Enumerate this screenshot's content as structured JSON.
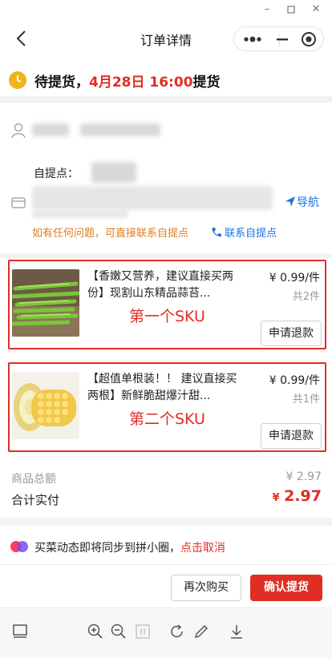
{
  "window": {
    "controls": [
      "minimize-icon",
      "maximize-icon",
      "close-icon"
    ]
  },
  "nav": {
    "title": "订单详情",
    "back_icon": "chevron-left-icon",
    "menu_icon": "more-dots-icon",
    "minimize_icon": "minimize-icon",
    "close_icon": "target-icon"
  },
  "status": {
    "prefix": "待提货，",
    "date_time": "4月28日 16:00",
    "suffix": "提货",
    "icon": "clock-icon"
  },
  "pickup": {
    "label": "自提点：",
    "navigate": "导航",
    "hint": "如有任何问题，可直接联系自提点",
    "contact": "联系自提点"
  },
  "items": [
    {
      "name": "【香嫩又营养，建议直接买两份】现割山东精品蒜苔...",
      "price": "¥ 0.99/件",
      "qty": "共2件",
      "sku_note": "第一个SKU",
      "refund": "申请退款"
    },
    {
      "name": "【超值单根装！！ 建议直接买两根】新鲜脆甜爆汁甜...",
      "price": "¥ 0.99/件",
      "qty": "共1件",
      "sku_note": "第二个SKU",
      "refund": "申请退款"
    }
  ],
  "totals": {
    "goods_label": "商品总额",
    "goods_value": "¥ 2.97",
    "paid_label": "合计实付",
    "paid_currency": "¥",
    "paid_value": "2.97"
  },
  "sync": {
    "text": "买菜动态即将同步到拼小圈，",
    "cancel": "点击取消"
  },
  "actions": {
    "buy_again": "再次购买",
    "confirm": "确认提货"
  },
  "toolbar": {
    "icons": [
      "panel-icon",
      "zoom-in-icon",
      "zoom-out-icon",
      "actual-size-icon",
      "rotate-icon",
      "edit-icon",
      "download-icon"
    ]
  },
  "colors": {
    "accent": "#e02e24",
    "link": "#1a73e8",
    "hint": "#e37d1a",
    "clock": "#f2b21a"
  }
}
